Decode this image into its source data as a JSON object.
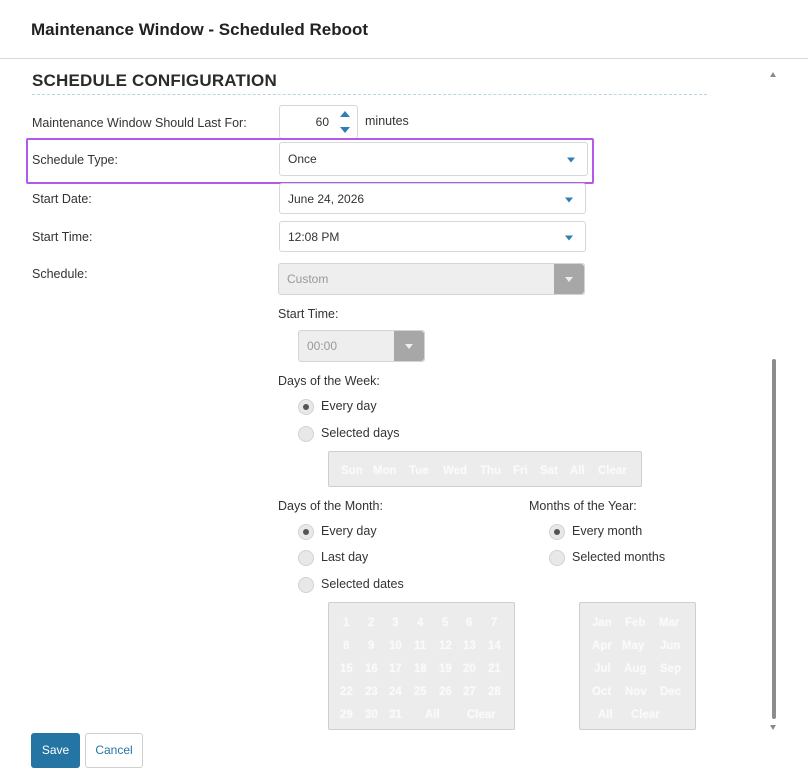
{
  "header": {
    "title": "Maintenance Window - Scheduled Reboot"
  },
  "section": {
    "title": "SCHEDULE CONFIGURATION"
  },
  "duration": {
    "label": "Maintenance Window Should Last For:",
    "value": "60",
    "unit": "minutes"
  },
  "schedule_type": {
    "label": "Schedule Type:",
    "value": "Once"
  },
  "start_date": {
    "label": "Start Date:",
    "value": "June 24, 2026"
  },
  "start_time": {
    "label": "Start Time:",
    "value": "12:08 PM"
  },
  "schedule": {
    "label": "Schedule:",
    "value": "Custom",
    "start_time_label": "Start Time:",
    "start_time_value": "00:00"
  },
  "days_of_week": {
    "label": "Days of the Week:",
    "options": [
      "Every day",
      "Selected days"
    ],
    "selected": "Every day",
    "picker": [
      "Sun",
      "Mon",
      "Tue",
      "Wed",
      "Thu",
      "Fri",
      "Sat",
      "All",
      "Clear"
    ]
  },
  "days_of_month": {
    "label": "Days of the Month:",
    "options": [
      "Every day",
      "Last day",
      "Selected dates"
    ],
    "selected": "Every day",
    "rows": [
      [
        "1",
        "2",
        "3",
        "4",
        "5",
        "6",
        "7"
      ],
      [
        "8",
        "9",
        "10",
        "11",
        "12",
        "13",
        "14"
      ],
      [
        "15",
        "16",
        "17",
        "18",
        "19",
        "20",
        "21"
      ],
      [
        "22",
        "23",
        "24",
        "25",
        "26",
        "27",
        "28"
      ],
      [
        "29",
        "30",
        "31"
      ]
    ],
    "all_label": "All",
    "clear_label": "Clear"
  },
  "months_of_year": {
    "label": "Months of the Year:",
    "options": [
      "Every month",
      "Selected months"
    ],
    "selected": "Every month",
    "rows": [
      [
        "Jan",
        "Feb",
        "Mar"
      ],
      [
        "Apr",
        "May",
        "Jun"
      ],
      [
        "Jul",
        "Aug",
        "Sep"
      ],
      [
        "Oct",
        "Nov",
        "Dec"
      ]
    ],
    "all_label": "All",
    "clear_label": "Clear"
  },
  "footer": {
    "save_label": "Save",
    "cancel_label": "Cancel"
  },
  "colors": {
    "accent": "#2475a3",
    "highlight": "#b35ae8",
    "disabled_button": "#a7a7a7"
  }
}
